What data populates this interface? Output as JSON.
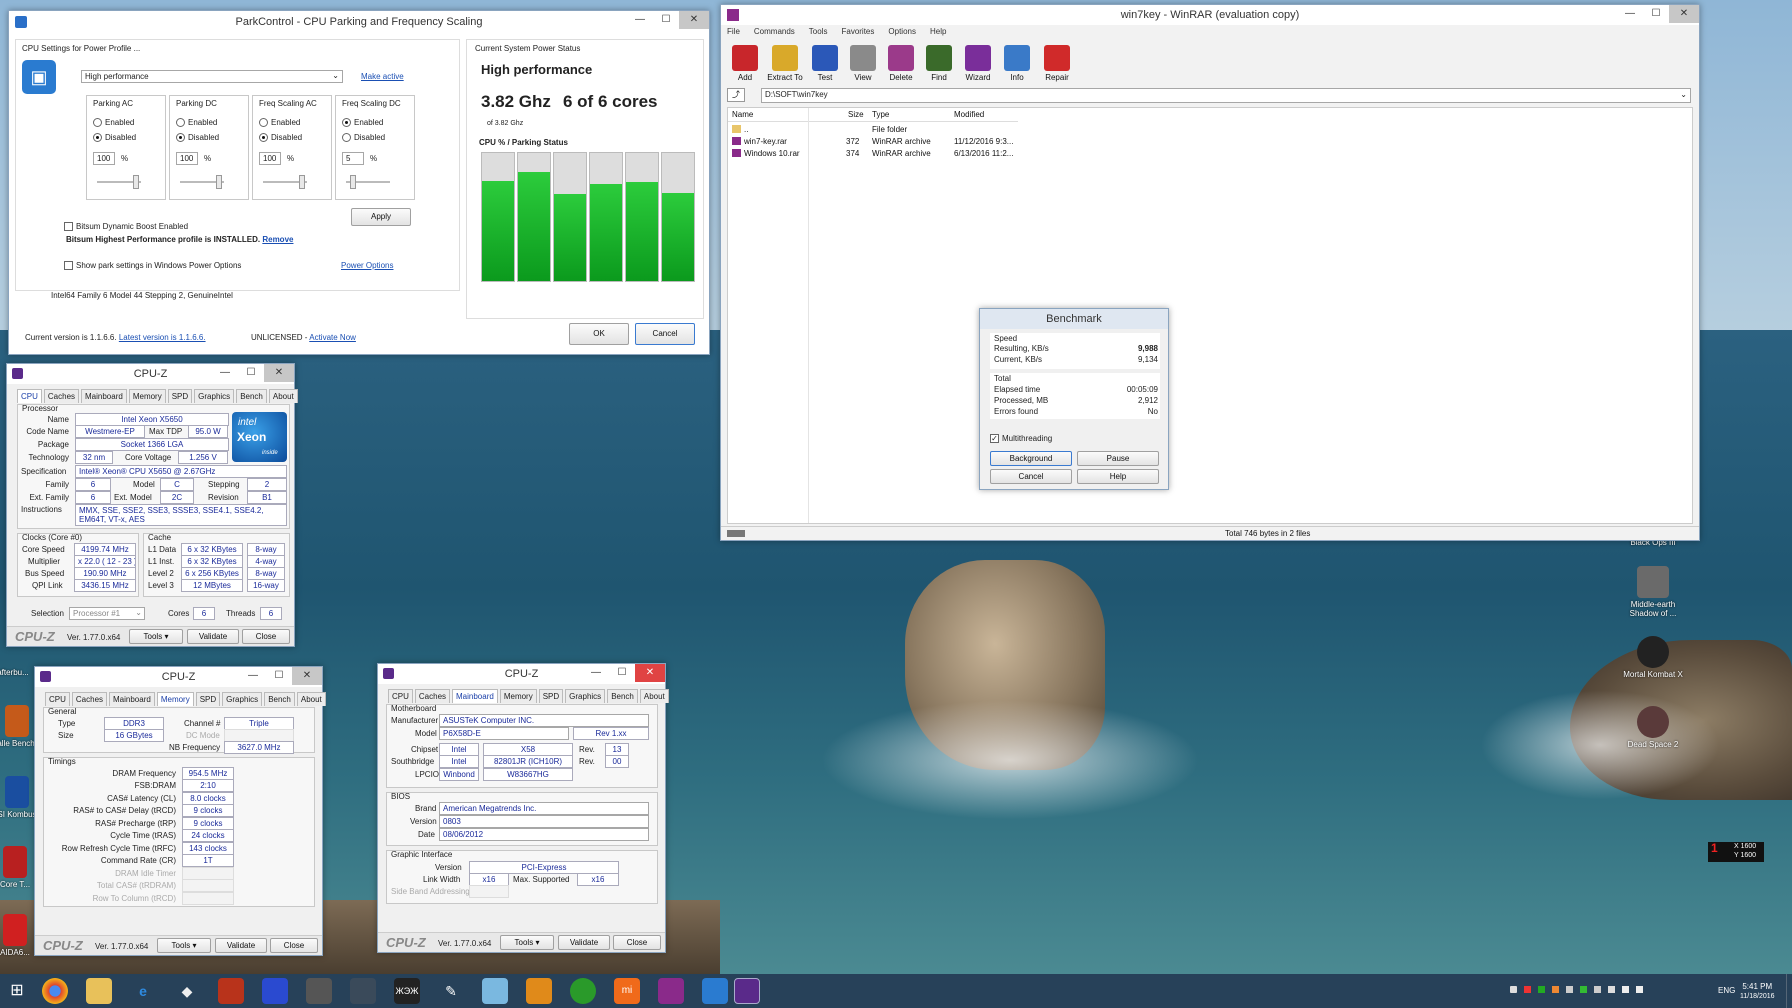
{
  "parkcontrol": {
    "title": "ParkControl - CPU Parking and Frequency Scaling",
    "settings_label": "CPU Settings for Power Profile ...",
    "profile_select": "High performance",
    "make_active": "Make active",
    "columns": [
      {
        "title": "Parking AC",
        "opt1": "Enabled",
        "opt2": "Disabled",
        "sel": 2,
        "value": "100",
        "unit": "%"
      },
      {
        "title": "Parking DC",
        "opt1": "Enabled",
        "opt2": "Disabled",
        "sel": 2,
        "value": "100",
        "unit": "%"
      },
      {
        "title": "Freq Scaling AC",
        "opt1": "Enabled",
        "opt2": "Disabled",
        "sel": 2,
        "value": "100",
        "unit": "%"
      },
      {
        "title": "Freq Scaling DC",
        "opt1": "Enabled",
        "opt2": "Disabled",
        "sel": 1,
        "value": "5",
        "unit": "%"
      }
    ],
    "apply": "Apply",
    "boost": "Bitsum Dynamic Boost Enabled",
    "installed": "Bitsum Highest Performance profile is INSTALLED.",
    "remove": "Remove",
    "show_park": "Show park settings in Windows Power Options",
    "power_options": "Power Options",
    "cpu_info": "Intel64 Family 6 Model 44 Stepping 2, GenuineIntel",
    "status_label": "Current System Power Status",
    "status_value": "High performance",
    "ghz": "3.82 Ghz",
    "cores": "6 of 6 cores",
    "of_ghz": "of 3.82 Ghz",
    "cpu_park_title": "CPU % / Parking Status",
    "core_load": [
      0.78,
      0.85,
      0.68,
      0.76,
      0.77,
      0.69
    ],
    "current_version": "Current version is 1.1.6.6.",
    "latest_version": "Latest version is 1.1.6.6.",
    "unlicensed": "UNLICENSED -",
    "activate": "Activate Now",
    "ok": "OK",
    "cancel": "Cancel"
  },
  "winrar": {
    "title": "win7key - WinRAR (evaluation copy)",
    "menu": [
      "File",
      "Commands",
      "Tools",
      "Favorites",
      "Options",
      "Help"
    ],
    "toolbar": [
      {
        "label": "Add",
        "icon": "add-archive-icon",
        "color": "#c8262b"
      },
      {
        "label": "Extract To",
        "icon": "extract-icon",
        "color": "#d9a92a"
      },
      {
        "label": "Test",
        "icon": "test-icon",
        "color": "#2b58b8"
      },
      {
        "label": "View",
        "icon": "view-icon",
        "color": "#8a8a8a"
      },
      {
        "label": "Delete",
        "icon": "delete-icon",
        "color": "#9b3a8a"
      },
      {
        "label": "Find",
        "icon": "find-icon",
        "color": "#3a6a2a"
      },
      {
        "label": "Wizard",
        "icon": "wizard-icon",
        "color": "#7a2e9a"
      },
      {
        "label": "Info",
        "icon": "info-icon",
        "color": "#3a7ac8"
      },
      {
        "label": "Repair",
        "icon": "repair-icon",
        "color": "#d02a2a"
      }
    ],
    "path": "D:\\SOFT\\win7key",
    "columns": [
      "Name",
      "Size",
      "Type",
      "Modified"
    ],
    "files": [
      {
        "name": "..",
        "size": "",
        "type": "File folder",
        "modified": ""
      },
      {
        "name": "win7-key.rar",
        "size": "372",
        "type": "WinRAR archive",
        "modified": "11/12/2016 9:3..."
      },
      {
        "name": "Windows 10.rar",
        "size": "374",
        "type": "WinRAR archive",
        "modified": "6/13/2016 11:2..."
      }
    ],
    "status": "Total 746 bytes in 2 files"
  },
  "benchmark": {
    "title": "Benchmark",
    "speed": "Speed",
    "resulting_label": "Resulting, KB/s",
    "resulting": "9,988",
    "current_label": "Current, KB/s",
    "current": "9,134",
    "total": "Total",
    "elapsed_label": "Elapsed time",
    "elapsed": "00:05:09",
    "processed_label": "Processed, MB",
    "processed": "2,912",
    "errors_label": "Errors found",
    "errors": "No",
    "multithreading": "Multithreading",
    "background": "Background",
    "pause": "Pause",
    "cancel": "Cancel",
    "help": "Help"
  },
  "cpuz_common": {
    "title": "CPU-Z",
    "version": "Ver. 1.77.0.x64",
    "tools": "Tools",
    "validate": "Validate",
    "close": "Close",
    "watermark": "CPU-Z",
    "tabs": [
      "CPU",
      "Caches",
      "Mainboard",
      "Memory",
      "SPD",
      "Graphics",
      "Bench",
      "About"
    ]
  },
  "cpuz_cpu": {
    "processor": "Processor",
    "name_l": "Name",
    "name": "Intel Xeon X5650",
    "codename_l": "Code Name",
    "codename": "Westmere-EP",
    "maxtdp_l": "Max TDP",
    "maxtdp": "95.0 W",
    "package_l": "Package",
    "package": "Socket 1366 LGA",
    "tech_l": "Technology",
    "tech": "32 nm",
    "voltage_l": "Core Voltage",
    "voltage": "1.256 V",
    "spec_l": "Specification",
    "spec": "Intel® Xeon® CPU        X5650  @ 2.67GHz",
    "family_l": "Family",
    "family": "6",
    "model_l": "Model",
    "model": "C",
    "stepping_l": "Stepping",
    "stepping": "2",
    "extfamily_l": "Ext. Family",
    "extfamily": "6",
    "extmodel_l": "Ext. Model",
    "extmodel": "2C",
    "revision_l": "Revision",
    "revision": "B1",
    "instr_l": "Instructions",
    "instr": "MMX, SSE, SSE2, SSE3, SSSE3, SSE4.1, SSE4.2, EM64T, VT-x, AES",
    "clocks": "Clocks (Core #0)",
    "corespeed_l": "Core Speed",
    "corespeed": "4199.74 MHz",
    "mult_l": "Multiplier",
    "mult": "x 22.0 ( 12 - 23 )",
    "bus_l": "Bus Speed",
    "bus": "190.90 MHz",
    "qpi_l": "QPI Link",
    "qpi": "3436.15 MHz",
    "cache": "Cache",
    "l1d_l": "L1 Data",
    "l1d": "6 x 32 KBytes",
    "l1d_w": "8-way",
    "l1i_l": "L1 Inst.",
    "l1i": "6 x 32 KBytes",
    "l1i_w": "4-way",
    "l2_l": "Level 2",
    "l2": "6 x 256 KBytes",
    "l2_w": "8-way",
    "l3_l": "Level 3",
    "l3": "12 MBytes",
    "l3_w": "16-way",
    "selection_l": "Selection",
    "selection": "Processor #1",
    "cores_l": "Cores",
    "cores": "6",
    "threads_l": "Threads",
    "threads": "6",
    "logo1": "intel",
    "logo2": "Xeon",
    "logo3": "inside"
  },
  "cpuz_mem": {
    "general": "General",
    "type_l": "Type",
    "type": "DDR3",
    "channel_l": "Channel #",
    "channel": "Triple",
    "size_l": "Size",
    "size": "16 GBytes",
    "dcmode_l": "DC Mode",
    "nbfreq_l": "NB Frequency",
    "nbfreq": "3627.0 MHz",
    "timings": "Timings",
    "rows": [
      {
        "l": "DRAM Frequency",
        "v": "954.5 MHz"
      },
      {
        "l": "FSB:DRAM",
        "v": "2:10"
      },
      {
        "l": "CAS# Latency (CL)",
        "v": "8.0 clocks"
      },
      {
        "l": "RAS# to CAS# Delay (tRCD)",
        "v": "9 clocks"
      },
      {
        "l": "RAS# Precharge (tRP)",
        "v": "9 clocks"
      },
      {
        "l": "Cycle Time (tRAS)",
        "v": "24 clocks"
      },
      {
        "l": "Row Refresh Cycle Time (tRFC)",
        "v": "143 clocks"
      },
      {
        "l": "Command Rate (CR)",
        "v": "1T"
      },
      {
        "l": "DRAM Idle Timer",
        "v": ""
      },
      {
        "l": "Total CAS# (tRDRAM)",
        "v": ""
      },
      {
        "l": "Row To Column (tRCD)",
        "v": ""
      }
    ]
  },
  "cpuz_mb": {
    "motherboard": "Motherboard",
    "manufacturer_l": "Manufacturer",
    "manufacturer": "ASUSTeK Computer INC.",
    "model_l": "Model",
    "model": "P6X58D-E",
    "rev": "Rev 1.xx",
    "chipset_l": "Chipset",
    "chipset_v": "Intel",
    "chipset": "X58",
    "chipset_rev_l": "Rev.",
    "chipset_rev": "13",
    "south_l": "Southbridge",
    "south_v": "Intel",
    "south": "82801JR (ICH10R)",
    "south_rev_l": "Rev.",
    "south_rev": "00",
    "lpcio_l": "LPCIO",
    "lpcio_v": "Winbond",
    "lpcio": "W83667HG",
    "bios": "BIOS",
    "brand_l": "Brand",
    "brand": "American Megatrends Inc.",
    "version_l": "Version",
    "version": "0803",
    "date_l": "Date",
    "date": "08/06/2012",
    "graphic": "Graphic Interface",
    "gver_l": "Version",
    "gver": "PCI-Express",
    "lw_l": "Link Width",
    "lw": "x16",
    "ms_l": "Max. Supported",
    "ms": "x16",
    "sba_l": "Side Band Addressing"
  },
  "desktop": {
    "icons": [
      {
        "label": "Black Ops III"
      },
      {
        "label": "Middle-earth Shadow of ..."
      },
      {
        "label": "Mortal Kombat X"
      },
      {
        "label": "Dead Space 2"
      }
    ],
    "left_icons": [
      {
        "label": "afterbu..."
      },
      {
        "label": "Valle Bench..."
      },
      {
        "label": "MSI Kombus..."
      },
      {
        "label": "Core T..."
      },
      {
        "label": "AIDA6..."
      }
    ],
    "overlay_x": "X 1600",
    "overlay_y": "Y 1600"
  },
  "taskbar": {
    "time": "5:41 PM",
    "date": "11/18/2016",
    "lang": "ENG"
  }
}
